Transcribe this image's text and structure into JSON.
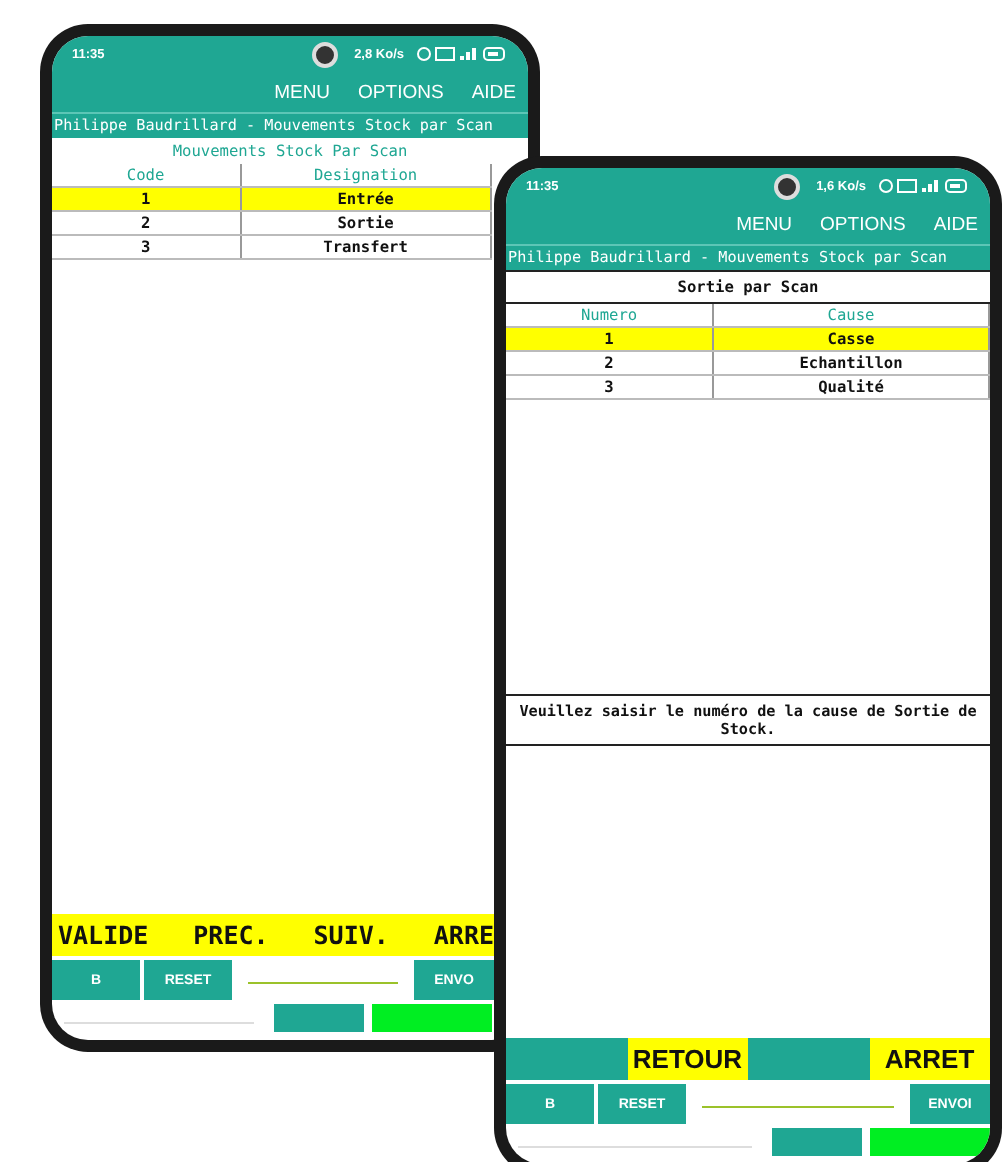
{
  "phones": [
    {
      "status": {
        "time": "11:35",
        "speed": "2,8 Ko/s"
      },
      "menu": [
        "MENU",
        "OPTIONS",
        "AIDE"
      ],
      "title": "Philippe Baudrillard - Mouvements Stock par Scan",
      "heading": {
        "text": "Mouvements Stock Par Scan",
        "kind": "caption"
      },
      "columns": [
        "Code",
        "Designation"
      ],
      "rows": [
        {
          "cells": [
            "1",
            "Entrée"
          ],
          "selected": true
        },
        {
          "cells": [
            "2",
            "Sortie"
          ],
          "selected": false
        },
        {
          "cells": [
            "3",
            "Transfert"
          ],
          "selected": false
        }
      ],
      "action_bar": [
        {
          "kind": "label",
          "label": "VALIDE"
        },
        {
          "kind": "label",
          "label": "PREC."
        },
        {
          "kind": "label",
          "label": "SUIV."
        },
        {
          "kind": "label",
          "label": "ARRE"
        }
      ],
      "controls": {
        "buttons": [
          "B",
          "RESET"
        ],
        "send": "ENVO"
      }
    },
    {
      "status": {
        "time": "11:35",
        "speed": "1,6 Ko/s"
      },
      "menu": [
        "MENU",
        "OPTIONS",
        "AIDE"
      ],
      "title": "Philippe Baudrillard - Mouvements Stock par Scan",
      "heading": {
        "text": "Sortie par Scan",
        "kind": "boxed"
      },
      "columns": [
        "Numero",
        "Cause"
      ],
      "rows": [
        {
          "cells": [
            "1",
            "Casse"
          ],
          "selected": true
        },
        {
          "cells": [
            "2",
            "Echantillon"
          ],
          "selected": false
        },
        {
          "cells": [
            "3",
            "Qualité"
          ],
          "selected": false
        }
      ],
      "message": "Veuillez saisir le numéro de la cause de Sortie de Stock.",
      "action_bar": [
        {
          "kind": "blank"
        },
        {
          "kind": "label",
          "label": "RETOUR"
        },
        {
          "kind": "blank"
        },
        {
          "kind": "label",
          "label": "ARRET"
        }
      ],
      "controls": {
        "buttons": [
          "B",
          "RESET"
        ],
        "send": "ENVOI"
      }
    }
  ]
}
